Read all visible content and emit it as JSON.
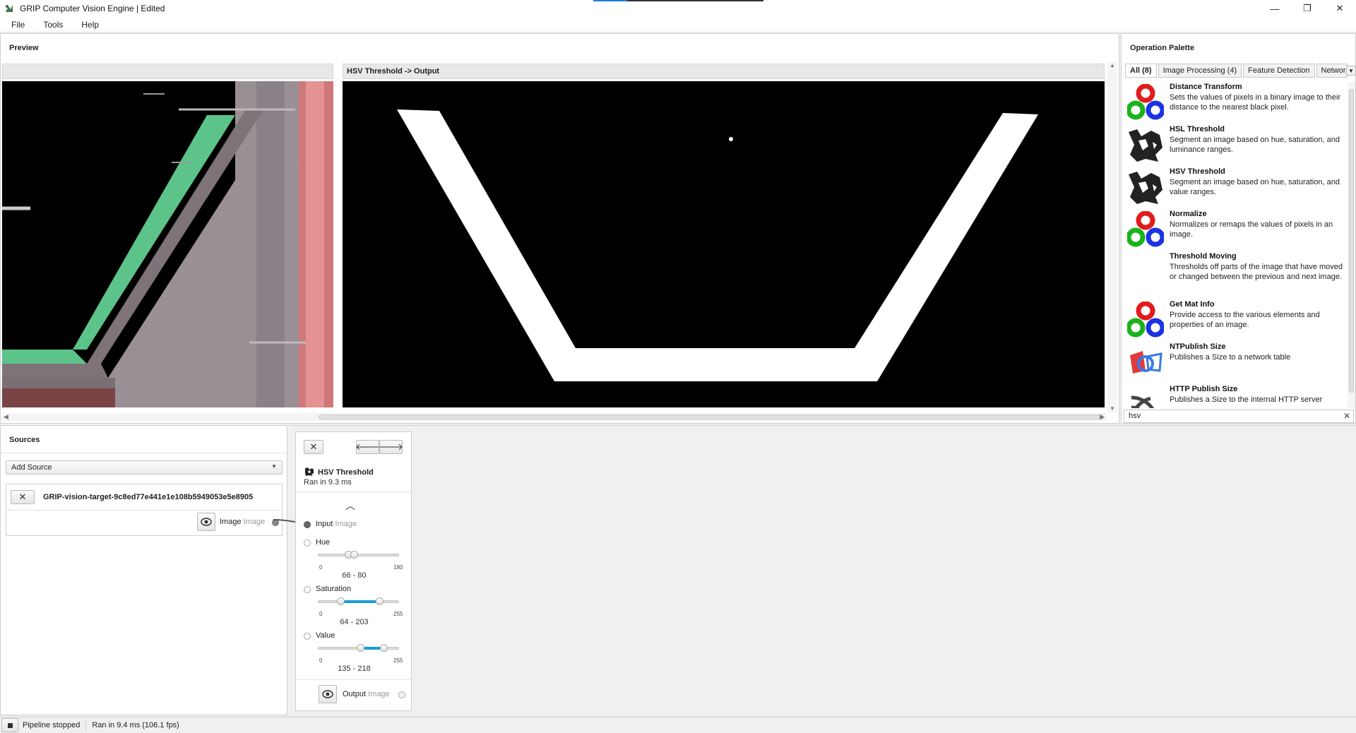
{
  "window": {
    "title": "GRIP Computer Vision Engine | Edited",
    "minimize": "—",
    "restore": "❐",
    "close": "✕"
  },
  "menu": [
    "File",
    "Tools",
    "Help"
  ],
  "preview": {
    "title": "Preview",
    "output_header": "HSV Threshold -> Output"
  },
  "palette": {
    "title": "Operation Palette",
    "tabs": [
      "All (8)",
      "Image Processing (4)",
      "Feature Detection",
      "Network"
    ],
    "search_value": "hsv",
    "operations": [
      {
        "name": "Distance Transform",
        "description": "Sets the values of pixels in a binary image to their distance to the nearest black pixel.",
        "icon": "opencv-icon"
      },
      {
        "name": "HSL Threshold",
        "description": "Segment an image based on hue, saturation, and luminance ranges.",
        "icon": "threshold-icon"
      },
      {
        "name": "HSV Threshold",
        "description": "Segment an image based on hue, saturation, and value ranges.",
        "icon": "threshold-icon"
      },
      {
        "name": "Normalize",
        "description": "Normalizes or remaps the values of pixels in an image.",
        "icon": "opencv-icon"
      },
      {
        "name": "Threshold Moving",
        "description": "Thresholds off parts of the image that have moved or changed between the previous and next image.",
        "icon": "none"
      },
      {
        "name": "Get Mat Info",
        "description": "Provide access to the various elements and properties of an image.",
        "icon": "opencv-icon"
      },
      {
        "name": "NTPublish Size",
        "description": "Publishes a Size to a network table",
        "icon": "first-logo-icon"
      },
      {
        "name": "HTTP Publish Size",
        "description": "Publishes a Size to the internal HTTP server",
        "icon": "wifi-icon"
      }
    ]
  },
  "sources": {
    "title": "Sources",
    "add_source": "Add Source",
    "source_name": "GRIP-vision-target-9c8ed77e441e1e108b5949053e5e8905",
    "socket_label": "Image",
    "socket_type": "Image"
  },
  "step": {
    "title": "HSV Threshold",
    "time": "Ran in 9.3 ms",
    "input_label": "Input",
    "input_type": "Image",
    "hue": {
      "label": "Hue",
      "min": "0",
      "max": "180",
      "range": "66 - 80",
      "low": 66,
      "high": 80,
      "scale": 180
    },
    "saturation": {
      "label": "Saturation",
      "min": "0",
      "max": "255",
      "range": "64 - 203",
      "low": 64,
      "high": 203,
      "scale": 255
    },
    "value": {
      "label": "Value",
      "min": "0",
      "max": "255",
      "range": "135 - 218",
      "low": 135,
      "high": 218,
      "scale": 255
    },
    "output_label": "Output",
    "output_type": "Image"
  },
  "status": {
    "pipeline": "Pipeline stopped",
    "timing": "Ran in 9.4 ms (106.1 fps)"
  },
  "colors": {
    "accent": "#1c9ad6",
    "target_green": "#5cc489",
    "led_red": "#e8535a"
  }
}
